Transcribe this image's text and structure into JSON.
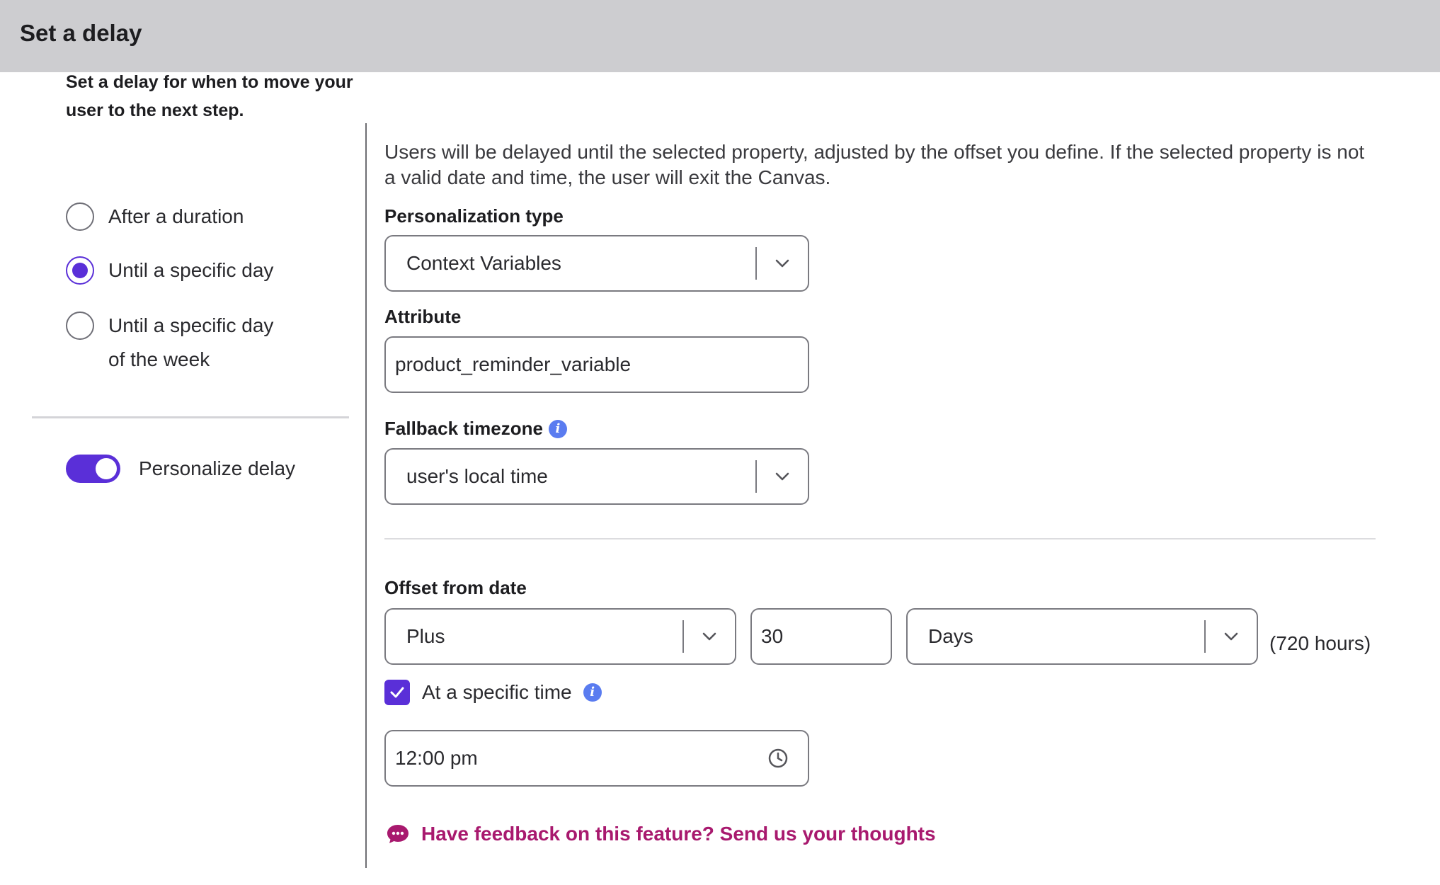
{
  "header": {
    "title": "Set a delay"
  },
  "left": {
    "intro": "Set a delay for when to move your user to the next step.",
    "options": [
      {
        "label": "After a duration",
        "checked": false
      },
      {
        "label": "Until a specific day",
        "checked": true
      },
      {
        "label": "Until a specific day of the week",
        "checked": false
      }
    ],
    "personalize": {
      "label": "Personalize delay",
      "on": true
    }
  },
  "main": {
    "description": "Users will be delayed until the selected property, adjusted by the offset you define. If the selected property is not a valid date and time, the user will exit the Canvas.",
    "personalization_type": {
      "label": "Personalization type",
      "value": "Context Variables"
    },
    "attribute": {
      "label": "Attribute",
      "value": "product_reminder_variable"
    },
    "fallback_timezone": {
      "label": "Fallback timezone",
      "value": "user's local time",
      "info_icon": "info-icon"
    },
    "offset": {
      "label": "Offset from date",
      "direction": "Plus",
      "amount": "30",
      "unit": "Days",
      "hours_note": "(720 hours)"
    },
    "specific_time": {
      "label": "At a specific time",
      "checked": true,
      "value": "12:00 pm"
    },
    "feedback": "Have feedback on this feature? Send us your thoughts"
  },
  "colors": {
    "accent": "#5a2fd8",
    "feedback": "#a8196e",
    "info": "#5a7cf0",
    "header_bg": "#cdcdd0"
  }
}
